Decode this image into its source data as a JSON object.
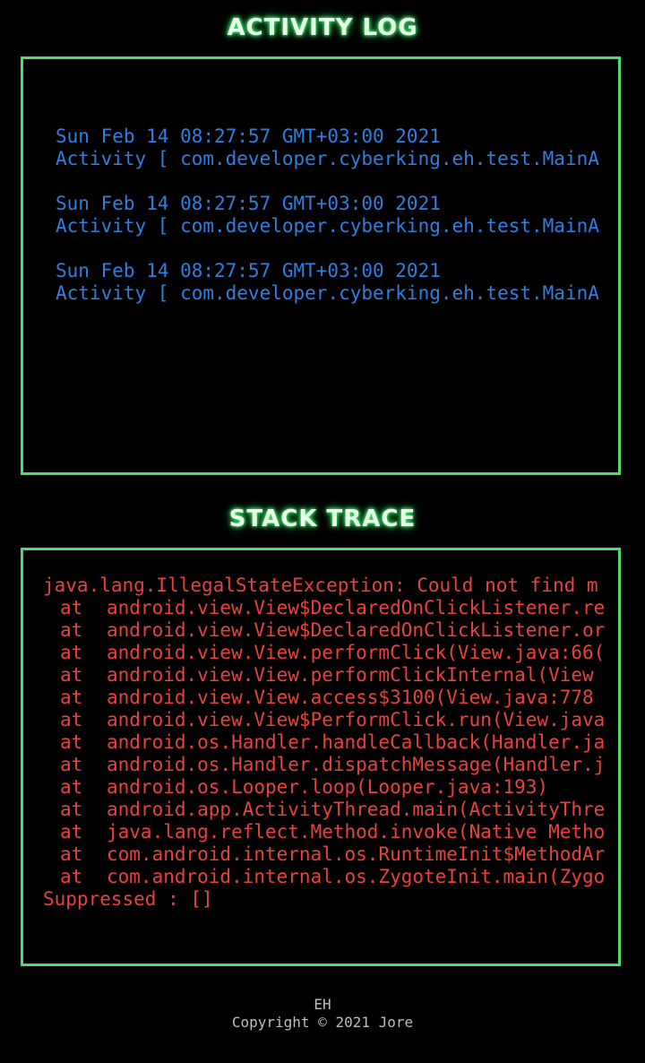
{
  "activity_log": {
    "title": "ACTIVITY LOG",
    "entries": [
      {
        "timestamp": "Sun Feb 14 08:27:57 GMT+03:00 2021",
        "activity": "Activity [ com.developer.cyberking.eh.test.MainA"
      },
      {
        "timestamp": "Sun Feb 14 08:27:57 GMT+03:00 2021",
        "activity": "Activity [ com.developer.cyberking.eh.test.MainA"
      },
      {
        "timestamp": "Sun Feb 14 08:27:57 GMT+03:00 2021",
        "activity": "Activity [ com.developer.cyberking.eh.test.MainA"
      }
    ]
  },
  "stack_trace": {
    "title": "STACK TRACE",
    "exception": "java.lang.IllegalStateException: Could not find m",
    "at_label": "at",
    "frames": [
      "android.view.View$DeclaredOnClickListener.re",
      "android.view.View$DeclaredOnClickListener.or",
      "android.view.View.performClick(View.java:66(",
      "android.view.View.performClickInternal(View",
      "android.view.View.access$3100(View.java:778",
      "android.view.View$PerformClick.run(View.java",
      "android.os.Handler.handleCallback(Handler.ja",
      "android.os.Handler.dispatchMessage(Handler.j",
      "android.os.Looper.loop(Looper.java:193)",
      "android.app.ActivityThread.main(ActivityThre",
      "java.lang.reflect.Method.invoke(Native Metho",
      "com.android.internal.os.RuntimeInit$MethodAr",
      "com.android.internal.os.ZygoteInit.main(Zygo"
    ],
    "suppressed": "Suppressed : []"
  },
  "footer": {
    "app_name": "EH",
    "copyright": "Copyright © 2021 Jore"
  },
  "colors": {
    "background": "#000000",
    "border": "#4ddc6e",
    "title_glow": "#3fe06a",
    "activity_text": "#2f7fe0",
    "trace_text": "#e9423c",
    "footer_text": "#bdbdbd"
  }
}
